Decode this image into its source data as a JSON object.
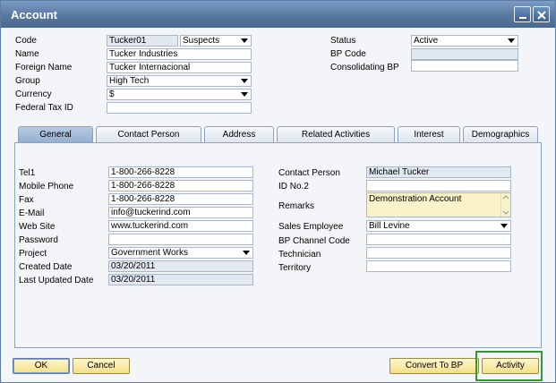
{
  "window": {
    "title": "Account"
  },
  "header": {
    "code_label": "Code",
    "code_value": "Tucker01",
    "code_type": "Suspects",
    "name_label": "Name",
    "name_value": "Tucker Industries",
    "foreign_name_label": "Foreign Name",
    "foreign_name_value": "Tucker Internacional",
    "group_label": "Group",
    "group_value": "High Tech",
    "currency_label": "Currency",
    "currency_value": "$",
    "federal_tax_label": "Federal Tax ID",
    "federal_tax_value": "",
    "status_label": "Status",
    "status_value": "Active",
    "bp_code_label": "BP Code",
    "bp_code_value": "",
    "consolidating_label": "Consolidating BP",
    "consolidating_value": ""
  },
  "tabs": [
    "General",
    "Contact Person",
    "Address",
    "Related Activities",
    "Interest",
    "Demographics"
  ],
  "general": {
    "tel1_label": "Tel1",
    "tel1_value": "1-800-266-8228",
    "mobile_label": "Mobile Phone",
    "mobile_value": "1-800-266-8228",
    "fax_label": "Fax",
    "fax_value": "1-800-266-8228",
    "email_label": "E-Mail",
    "email_value": "info@tuckerind.com",
    "website_label": "Web Site",
    "website_value": "www.tuckerind.com",
    "password_label": "Password",
    "password_value": "",
    "project_label": "Project",
    "project_value": "Government Works",
    "created_label": "Created Date",
    "created_value": "03/20/2011",
    "updated_label": "Last Updated Date",
    "updated_value": "03/20/2011",
    "contact_label": "Contact Person",
    "contact_value": "Michael Tucker",
    "id2_label": "ID No.2",
    "id2_value": "",
    "remarks_label": "Remarks",
    "remarks_value": "Demonstration Account",
    "sales_label": "Sales Employee",
    "sales_value": "Bill Levine",
    "channel_label": "BP Channel Code",
    "channel_value": "",
    "technician_label": "Technician",
    "technician_value": "",
    "territory_label": "Territory",
    "territory_value": ""
  },
  "buttons": {
    "ok": "OK",
    "cancel": "Cancel",
    "convert": "Convert To BP",
    "activity": "Activity"
  },
  "colors": {
    "titlebar": "#58789f",
    "button": "#f2df86",
    "highlight": "#2f9a2f",
    "remarks_bg": "#fbf3c8"
  }
}
